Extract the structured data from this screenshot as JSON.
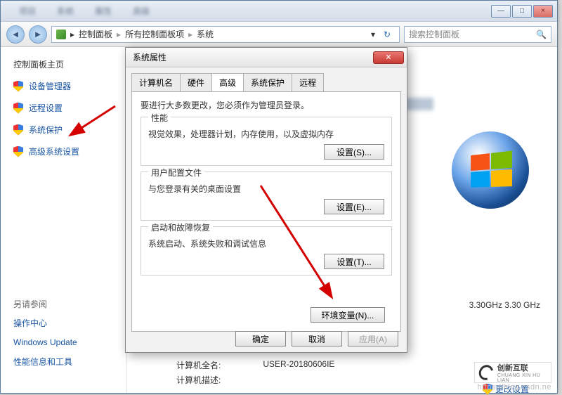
{
  "titlebar_blur": [
    "项目",
    "系统",
    "属性",
    "高级"
  ],
  "window_buttons": {
    "min": "—",
    "max": "□",
    "close": "×"
  },
  "breadcrumb": {
    "root": "控制面板",
    "mid": "所有控制面板项",
    "leaf": "系统"
  },
  "search": {
    "placeholder": "搜索控制面板"
  },
  "sidebar": {
    "heading": "控制面板主页",
    "items": [
      {
        "label": "设备管理器"
      },
      {
        "label": "远程设置"
      },
      {
        "label": "系统保护"
      },
      {
        "label": "高级系统设置"
      }
    ],
    "see_also_heading": "另请参阅",
    "lower": [
      "操作中心",
      "Windows Update",
      "性能信息和工具"
    ]
  },
  "spec": {
    "freq": "3.30GHz   3.30 GHz"
  },
  "change_settings": "更改设置",
  "compinfo": {
    "name_label": "计算机全名:",
    "name_value": "USER-20180606IE",
    "desc_label": "计算机描述:"
  },
  "dialog": {
    "title": "系统属性",
    "tabs": [
      "计算机名",
      "硬件",
      "高级",
      "系统保护",
      "远程"
    ],
    "active_tab_index": 2,
    "notice": "要进行大多数更改，您必须作为管理员登录。",
    "groups": [
      {
        "legend": "性能",
        "desc": "视觉效果，处理器计划，内存使用，以及虚拟内存",
        "btn": "设置(S)..."
      },
      {
        "legend": "用户配置文件",
        "desc": "与您登录有关的桌面设置",
        "btn": "设置(E)..."
      },
      {
        "legend": "启动和故障恢复",
        "desc": "系统启动、系统失败和调试信息",
        "btn": "设置(T)..."
      }
    ],
    "env_btn": "环境变量(N)...",
    "ok": "确定",
    "cancel": "取消",
    "apply": "应用(A)"
  },
  "watermark": "https://blog.csdn.ne",
  "cxbrand": {
    "cn": "创新互联",
    "py": "CHUANG XIN HU LIAN"
  }
}
